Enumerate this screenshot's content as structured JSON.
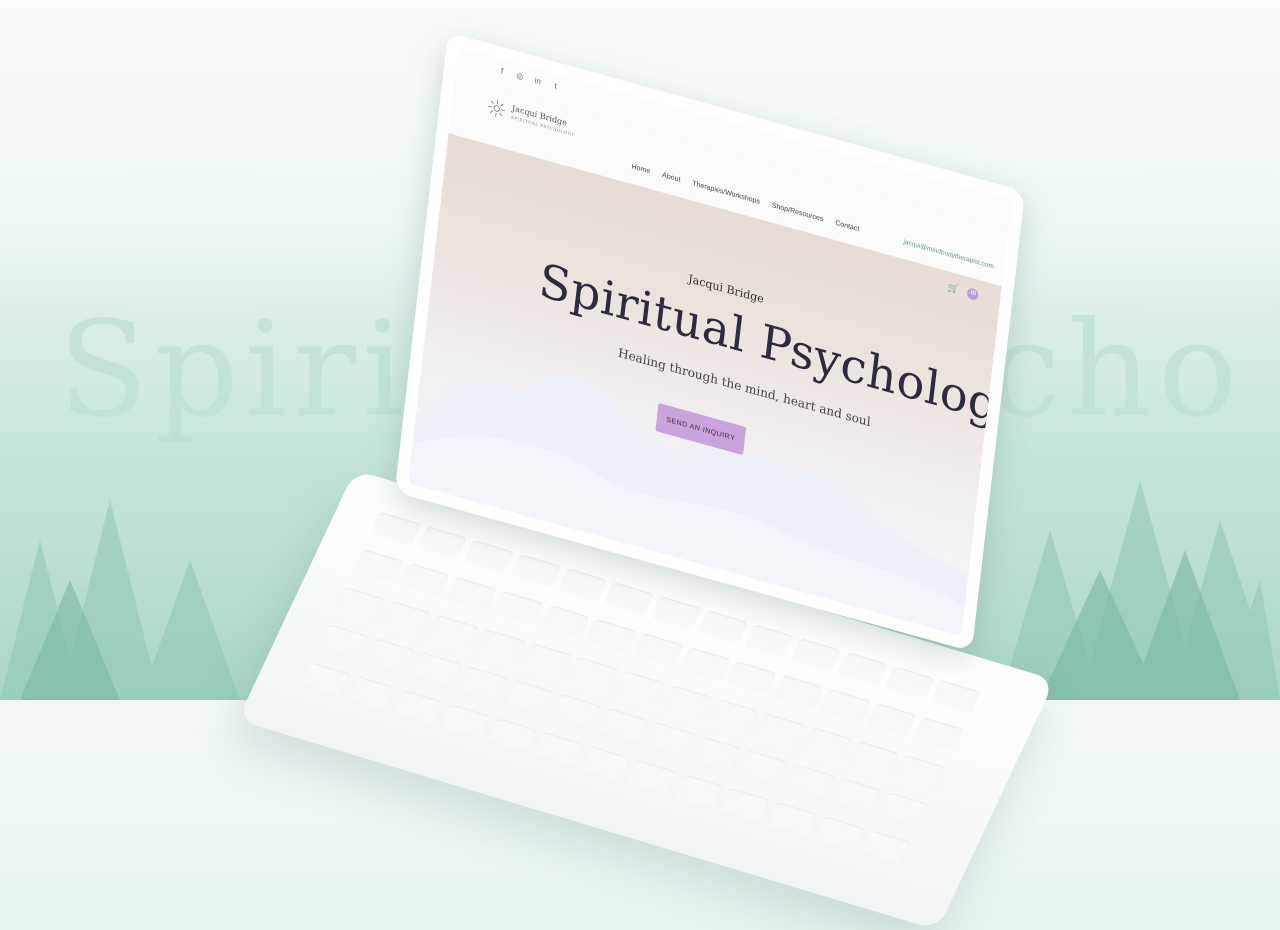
{
  "background": {
    "word": "Spiritual Psychology",
    "colors": {
      "sky": "#eef7f5",
      "forest": "#a9d6c8",
      "word": "#bfe0d5"
    }
  },
  "site": {
    "social_icons": [
      {
        "name": "facebook-icon",
        "glyph": "f"
      },
      {
        "name": "instagram-icon",
        "glyph": "◎"
      },
      {
        "name": "linkedin-icon",
        "glyph": "in"
      },
      {
        "name": "twitter-icon",
        "glyph": "t"
      }
    ],
    "logo": {
      "name": "Jacqui Bridge",
      "tagline": "SPIRITUAL PSYCHOLOGY"
    },
    "nav": [
      "Home",
      "About",
      "Therapies/Workshops",
      "Shop/Resources",
      "Contact"
    ],
    "email": "jacqui@mindbodytherapist.com",
    "avatar_initial": "JB",
    "hero": {
      "name": "Jacqui Bridge",
      "title": "Spiritual Psychology",
      "subtitle": "Healing through the mind, heart and soul",
      "cta": "SEND AN INQUIRY"
    },
    "accent_color": "#c8a3dc"
  }
}
